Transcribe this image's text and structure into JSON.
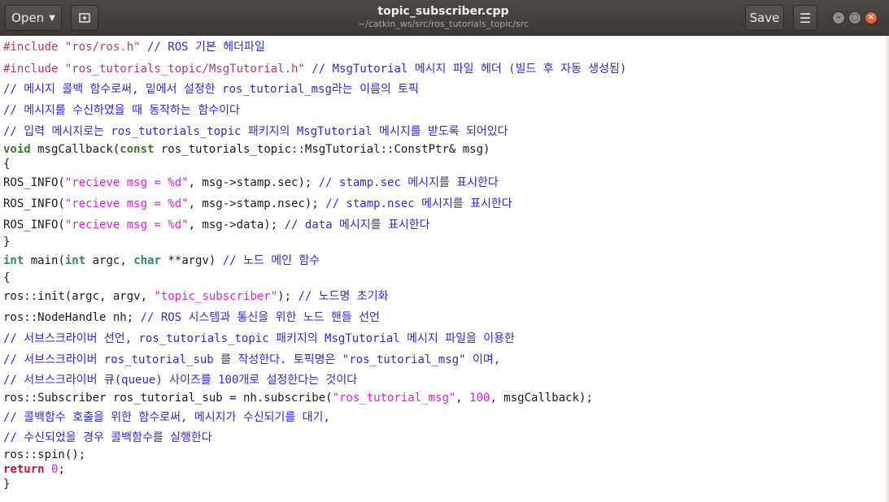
{
  "header": {
    "open_label": "Open",
    "title": "topic_subscriber.cpp",
    "subtitle": "~/catkin_ws/src/ros_tutorials_topic/src",
    "save_label": "Save"
  },
  "code": {
    "l1": {
      "a": "#include ",
      "b": "\"ros/ros.h\"",
      "c": " // ROS 기본 헤더파일"
    },
    "l2": {
      "a": "#include ",
      "b": "\"ros_tutorials_topic/MsgTutorial.h\"",
      "c": " // MsgTutorial 메시지 파일 헤더 (빌드 후 자동 생성됨)"
    },
    "l3": "// 메시지 콜백 함수로써, 밑에서 설정한 ros_tutorial_msg라는 이름의 토픽",
    "l4": "// 메시지를 수신하였을 때 동작하는 함수이다",
    "l5": "// 입력 메시지로는 ros_tutorials_topic 패키지의 MsgTutorial 메시지를 받도록 되어있다",
    "l6": {
      "kw1": "void",
      "a": " msgCallback(",
      "kw2": "const",
      "b": " ros_tutorials_topic::MsgTutorial::ConstPtr& msg)"
    },
    "l7": "{",
    "l8": {
      "a": "ROS_INFO(",
      "s": "\"recieve msg = %d\"",
      "b": ", msg->stamp.sec); ",
      "c": "// stamp.sec 메시지를 표시한다"
    },
    "l9": {
      "a": "ROS_INFO(",
      "s": "\"recieve msg = %d\"",
      "b": ", msg->stamp.nsec); ",
      "c": "// stamp.nsec 메시지를 표시한다"
    },
    "l10": {
      "a": "ROS_INFO(",
      "s": "\"recieve msg = %d\"",
      "b": ", msg->data); ",
      "c": "// data 메시지를 표시한다"
    },
    "l11": "}",
    "l12": {
      "t1": "int",
      "a": " main(",
      "t2": "int",
      "b": " argc, ",
      "t3": "char",
      "d": " **argv) ",
      "c": "// 노드 메인 함수"
    },
    "l13": "{",
    "l14": {
      "a": "ros::init(argc, argv, ",
      "s": "\"topic_subscriber\"",
      "b": "); ",
      "c": "// 노드명 초기화"
    },
    "l15": {
      "a": "ros::NodeHandle nh; ",
      "c": "// ROS 시스템과 통신을 위한 노드 핸들 선언"
    },
    "l16": "// 서브스크라이버 선언, ros_tutorials_topic 패키지의 MsgTutorial 메시지 파일을 이용한",
    "l17": "// 서브스크라이버 ros_tutorial_sub 를 작성한다. 토픽명은 \"ros_tutorial_msg\" 이며,",
    "l18": "// 서브스크라이버 큐(queue) 사이즈를 100개로 설정한다는 것이다",
    "l19": {
      "a": "ros::Subscriber ros_tutorial_sub = nh.subscribe(",
      "s": "\"ros_tutorial_msg\"",
      "b": ", ",
      "n": "100",
      "d": ", msgCallback);"
    },
    "l20": "// 콜백함수 호출을 위한 함수로써, 메시지가 수신되기를 대기,",
    "l21": "// 수신되었을 경우 콜백함수를 실행한다",
    "l22": "ros::spin();",
    "l23": {
      "kw": "return",
      "a": " ",
      "n": "0",
      "b": ";"
    },
    "l24": "}"
  }
}
